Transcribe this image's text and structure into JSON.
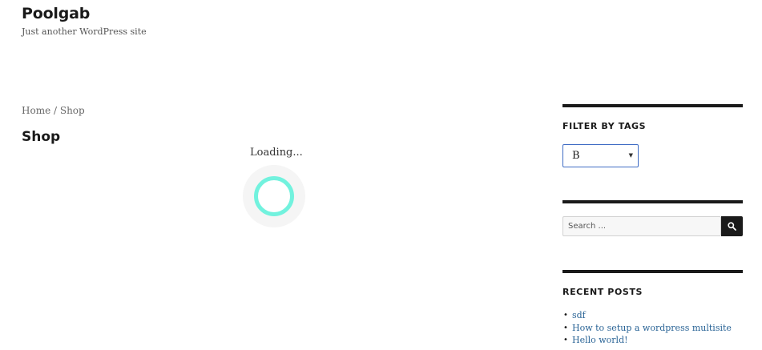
{
  "site": {
    "title": "Poolgab",
    "tagline": "Just another WordPress site"
  },
  "breadcrumb": {
    "home": "Home",
    "separator": " / ",
    "current": "Shop"
  },
  "main": {
    "title": "Shop",
    "loading_text": "Loading..."
  },
  "sidebar": {
    "filter_widget": {
      "title": "FILTER BY TAGS",
      "selected": "B"
    },
    "search_widget": {
      "placeholder": "Search ..."
    },
    "recent_posts": {
      "title": "RECENT POSTS",
      "items": [
        {
          "label": "sdf"
        },
        {
          "label": "How to setup a wordpress multisite"
        },
        {
          "label": "Hello world!"
        }
      ]
    }
  },
  "colors": {
    "spinner": "#72f2de",
    "link": "#2a6496",
    "focus_border": "#3f6cc4"
  },
  "icons": {
    "search_button": "search-icon",
    "select_arrow": "triangle-down-icon"
  }
}
